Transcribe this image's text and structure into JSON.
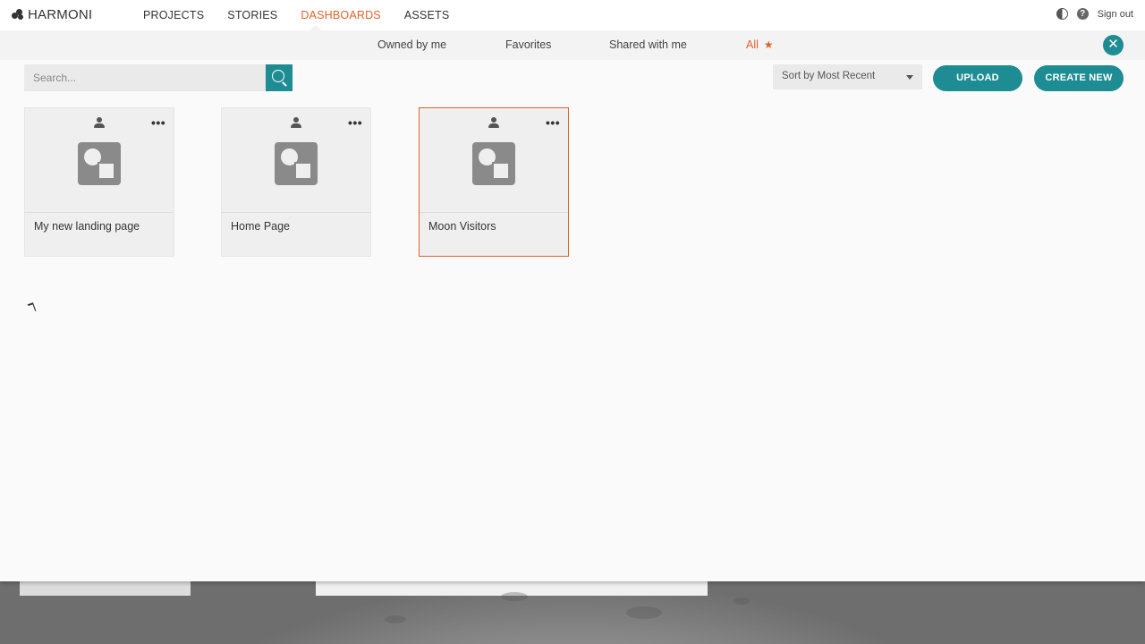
{
  "app": {
    "logo_text": "HARMONI"
  },
  "mainnav": {
    "items": [
      {
        "label": "PROJECTS",
        "active": false
      },
      {
        "label": "STORIES",
        "active": false
      },
      {
        "label": "DASHBOARDS",
        "active": true
      },
      {
        "label": "ASSETS",
        "active": false
      }
    ]
  },
  "header_right": {
    "contrast_icon": "contrast-icon",
    "help_icon": "help-icon",
    "help_glyph": "?",
    "signout_label": "Sign out"
  },
  "filters": {
    "items": [
      {
        "label": "Owned by me",
        "active": false
      },
      {
        "label": "Favorites",
        "active": false
      },
      {
        "label": "Shared with me",
        "active": false
      },
      {
        "label": "All",
        "active": true,
        "icon": "star-icon"
      }
    ],
    "close_icon": "close-icon"
  },
  "toolbar": {
    "search_placeholder": "Search...",
    "search_value": "",
    "sort_label": "Sort by Most Recent",
    "upload_label": "UPLOAD",
    "create_label": "CREATE NEW"
  },
  "dashboards": [
    {
      "title": "My new landing page",
      "selected": false
    },
    {
      "title": "Home Page",
      "selected": false
    },
    {
      "title": "Moon Visitors",
      "selected": true
    }
  ],
  "colors": {
    "accent": "#1e8c93",
    "active": "#e0622a"
  }
}
